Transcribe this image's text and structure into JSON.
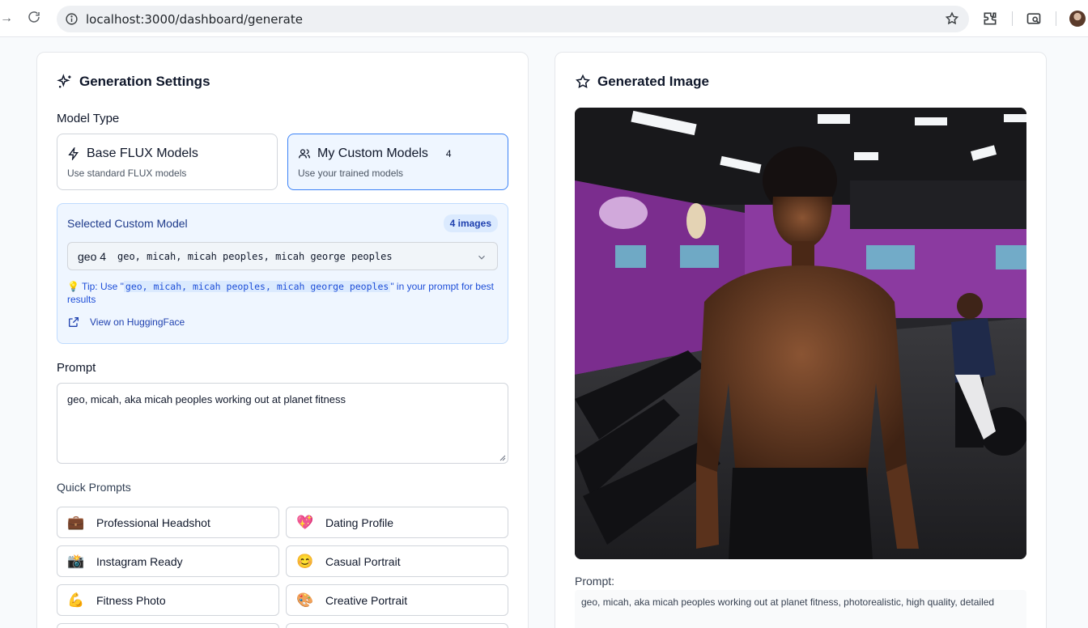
{
  "browser": {
    "url": "localhost:3000/dashboard/generate"
  },
  "settings": {
    "title": "Generation Settings",
    "model_type_label": "Model Type",
    "base_models": {
      "title": "Base FLUX Models",
      "subtitle": "Use standard FLUX models"
    },
    "custom_models": {
      "title": "My Custom Models",
      "count": "4",
      "subtitle": "Use your trained models"
    },
    "selected_model": {
      "title": "Selected Custom Model",
      "images_badge": "4 images",
      "name": "geo 4",
      "trigger_words": "geo, micah, micah peoples, micah george peoples",
      "tip_prefix": "💡 Tip: Use \"",
      "tip_code": "geo, micah, micah peoples, micah george peoples",
      "tip_suffix": "\" in your prompt for best results",
      "link_label": "View on HuggingFace"
    },
    "prompt_label": "Prompt",
    "prompt_value": "geo, micah, aka micah peoples working out at planet fitness",
    "quick_prompts_label": "Quick Prompts",
    "quick_prompts": [
      {
        "icon": "💼",
        "label": "Professional Headshot"
      },
      {
        "icon": "💖",
        "label": "Dating Profile"
      },
      {
        "icon": "📸",
        "label": "Instagram Ready"
      },
      {
        "icon": "😊",
        "label": "Casual Portrait"
      },
      {
        "icon": "💪",
        "label": "Fitness Photo"
      },
      {
        "icon": "🎨",
        "label": "Creative Portrait"
      }
    ]
  },
  "output": {
    "title": "Generated Image",
    "prompt_label": "Prompt:",
    "prompt_value": "geo, micah, aka micah peoples working out at planet fitness, photorealistic, high quality, detailed"
  },
  "colors": {
    "accent": "#3b82f6",
    "selected_bg": "#eff6ff",
    "link": "#1e40af",
    "gym_purple": "#7b2d8e"
  }
}
